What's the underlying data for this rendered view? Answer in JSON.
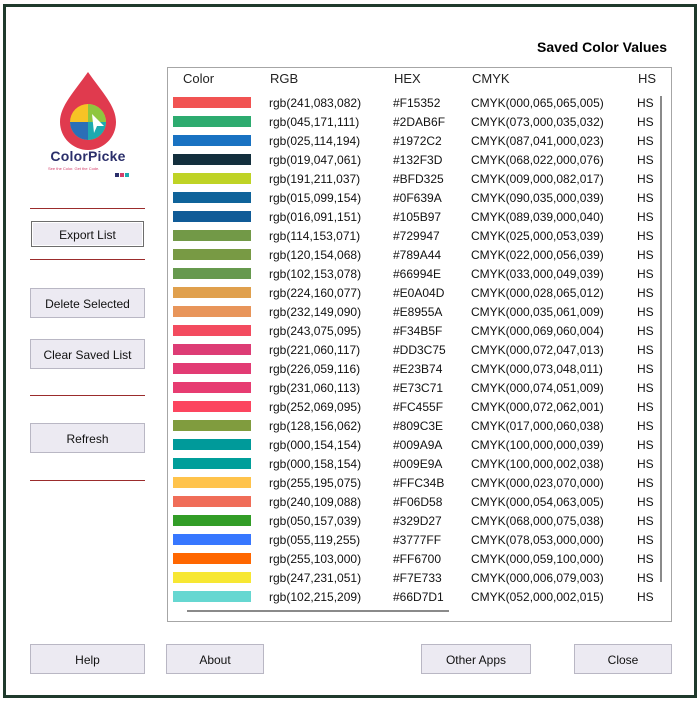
{
  "title": "Saved Color Values",
  "logo": {
    "name": "ColorPicke",
    "tagline": "See the Color. Get the Code.",
    "dots": [
      "#2b2f6b",
      "#d43d6a",
      "#1eaab0"
    ]
  },
  "buttons": {
    "export": "Export List",
    "delete": "Delete Selected",
    "clear": "Clear Saved List",
    "refresh": "Refresh",
    "help": "Help",
    "about": "About",
    "other_apps": "Other Apps",
    "close": "Close"
  },
  "columns": {
    "color": "Color",
    "rgb": "RGB",
    "hex": "HEX",
    "cmyk": "CMYK",
    "hsl": "HS"
  },
  "rows": [
    {
      "swatch": "#F15352",
      "rgb": "rgb(241,083,082)",
      "hex": "#F15352",
      "cmyk": "CMYK(000,065,065,005)",
      "hsl": "HS"
    },
    {
      "swatch": "#2DAB6F",
      "rgb": "rgb(045,171,111)",
      "hex": "#2DAB6F",
      "cmyk": "CMYK(073,000,035,032)",
      "hsl": "HS"
    },
    {
      "swatch": "#1972C2",
      "rgb": "rgb(025,114,194)",
      "hex": "#1972C2",
      "cmyk": "CMYK(087,041,000,023)",
      "hsl": "HS"
    },
    {
      "swatch": "#132F3D",
      "rgb": "rgb(019,047,061)",
      "hex": "#132F3D",
      "cmyk": "CMYK(068,022,000,076)",
      "hsl": "HS"
    },
    {
      "swatch": "#BFD325",
      "rgb": "rgb(191,211,037)",
      "hex": "#BFD325",
      "cmyk": "CMYK(009,000,082,017)",
      "hsl": "HS"
    },
    {
      "swatch": "#0F639A",
      "rgb": "rgb(015,099,154)",
      "hex": "#0F639A",
      "cmyk": "CMYK(090,035,000,039)",
      "hsl": "HS"
    },
    {
      "swatch": "#105B97",
      "rgb": "rgb(016,091,151)",
      "hex": "#105B97",
      "cmyk": "CMYK(089,039,000,040)",
      "hsl": "HS"
    },
    {
      "swatch": "#729947",
      "rgb": "rgb(114,153,071)",
      "hex": "#729947",
      "cmyk": "CMYK(025,000,053,039)",
      "hsl": "HS"
    },
    {
      "swatch": "#789A44",
      "rgb": "rgb(120,154,068)",
      "hex": "#789A44",
      "cmyk": "CMYK(022,000,056,039)",
      "hsl": "HS"
    },
    {
      "swatch": "#66994E",
      "rgb": "rgb(102,153,078)",
      "hex": "#66994E",
      "cmyk": "CMYK(033,000,049,039)",
      "hsl": "HS"
    },
    {
      "swatch": "#E0A04D",
      "rgb": "rgb(224,160,077)",
      "hex": "#E0A04D",
      "cmyk": "CMYK(000,028,065,012)",
      "hsl": "HS"
    },
    {
      "swatch": "#E8955A",
      "rgb": "rgb(232,149,090)",
      "hex": "#E8955A",
      "cmyk": "CMYK(000,035,061,009)",
      "hsl": "HS"
    },
    {
      "swatch": "#F34B5F",
      "rgb": "rgb(243,075,095)",
      "hex": "#F34B5F",
      "cmyk": "CMYK(000,069,060,004)",
      "hsl": "HS"
    },
    {
      "swatch": "#DD3C75",
      "rgb": "rgb(221,060,117)",
      "hex": "#DD3C75",
      "cmyk": "CMYK(000,072,047,013)",
      "hsl": "HS"
    },
    {
      "swatch": "#E23B74",
      "rgb": "rgb(226,059,116)",
      "hex": "#E23B74",
      "cmyk": "CMYK(000,073,048,011)",
      "hsl": "HS"
    },
    {
      "swatch": "#E73C71",
      "rgb": "rgb(231,060,113)",
      "hex": "#E73C71",
      "cmyk": "CMYK(000,074,051,009)",
      "hsl": "HS"
    },
    {
      "swatch": "#FC455F",
      "rgb": "rgb(252,069,095)",
      "hex": "#FC455F",
      "cmyk": "CMYK(000,072,062,001)",
      "hsl": "HS"
    },
    {
      "swatch": "#809C3E",
      "rgb": "rgb(128,156,062)",
      "hex": "#809C3E",
      "cmyk": "CMYK(017,000,060,038)",
      "hsl": "HS"
    },
    {
      "swatch": "#009A9A",
      "rgb": "rgb(000,154,154)",
      "hex": "#009A9A",
      "cmyk": "CMYK(100,000,000,039)",
      "hsl": "HS"
    },
    {
      "swatch": "#009E9A",
      "rgb": "rgb(000,158,154)",
      "hex": "#009E9A",
      "cmyk": "CMYK(100,000,002,038)",
      "hsl": "HS"
    },
    {
      "swatch": "#FFC34B",
      "rgb": "rgb(255,195,075)",
      "hex": "#FFC34B",
      "cmyk": "CMYK(000,023,070,000)",
      "hsl": "HS"
    },
    {
      "swatch": "#F06D58",
      "rgb": "rgb(240,109,088)",
      "hex": "#F06D58",
      "cmyk": "CMYK(000,054,063,005)",
      "hsl": "HS"
    },
    {
      "swatch": "#329D27",
      "rgb": "rgb(050,157,039)",
      "hex": "#329D27",
      "cmyk": "CMYK(068,000,075,038)",
      "hsl": "HS"
    },
    {
      "swatch": "#3777FF",
      "rgb": "rgb(055,119,255)",
      "hex": "#3777FF",
      "cmyk": "CMYK(078,053,000,000)",
      "hsl": "HS"
    },
    {
      "swatch": "#FF6700",
      "rgb": "rgb(255,103,000)",
      "hex": "#FF6700",
      "cmyk": "CMYK(000,059,100,000)",
      "hsl": "HS"
    },
    {
      "swatch": "#F7E733",
      "rgb": "rgb(247,231,051)",
      "hex": "#F7E733",
      "cmyk": "CMYK(000,006,079,003)",
      "hsl": "HS"
    },
    {
      "swatch": "#66D7D1",
      "rgb": "rgb(102,215,209)",
      "hex": "#66D7D1",
      "cmyk": "CMYK(052,000,002,015)",
      "hsl": "HS"
    }
  ]
}
